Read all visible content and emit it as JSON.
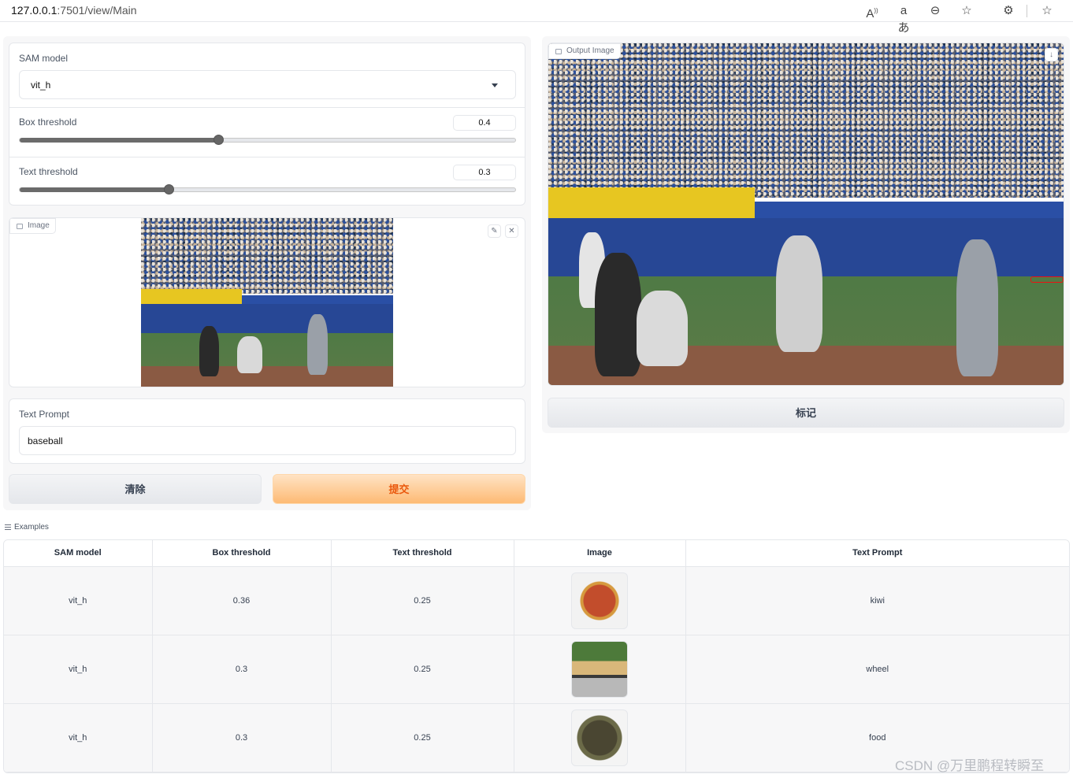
{
  "browser": {
    "url_host": "127.0.0.1",
    "url_path": ":7501/view/Main",
    "icons": [
      "read-aloud-icon",
      "translate-icon",
      "zoom-icon",
      "favorite-icon",
      "extensions-icon",
      "favorites-bar-icon"
    ]
  },
  "left": {
    "sam_model": {
      "label": "SAM model",
      "value": "vit_h"
    },
    "box_threshold": {
      "label": "Box threshold",
      "value": "0.4",
      "level": 0.4
    },
    "text_threshold": {
      "label": "Text threshold",
      "value": "0.3",
      "level": 0.3
    },
    "image": {
      "label": "Image"
    },
    "text_prompt": {
      "label": "Text Prompt",
      "value": "baseball"
    },
    "clear_button": "清除",
    "submit_button": "提交"
  },
  "right": {
    "output_image": {
      "label": "Output Image"
    },
    "mark_button": "标记"
  },
  "examples": {
    "label": "Examples",
    "headers": [
      "SAM model",
      "Box threshold",
      "Text threshold",
      "Image",
      "Text Prompt"
    ],
    "rows": [
      {
        "sam_model": "vit_h",
        "box_threshold": "0.36",
        "text_threshold": "0.25",
        "image": "fruit-bowl-thumbnail",
        "text_prompt": "kiwi"
      },
      {
        "sam_model": "vit_h",
        "box_threshold": "0.3",
        "text_threshold": "0.25",
        "image": "car-thumbnail",
        "text_prompt": "wheel"
      },
      {
        "sam_model": "vit_h",
        "box_threshold": "0.3",
        "text_threshold": "0.25",
        "image": "food-plate-thumbnail",
        "text_prompt": "food"
      }
    ]
  },
  "watermark": "CSDN @万里鹏程转瞬至"
}
